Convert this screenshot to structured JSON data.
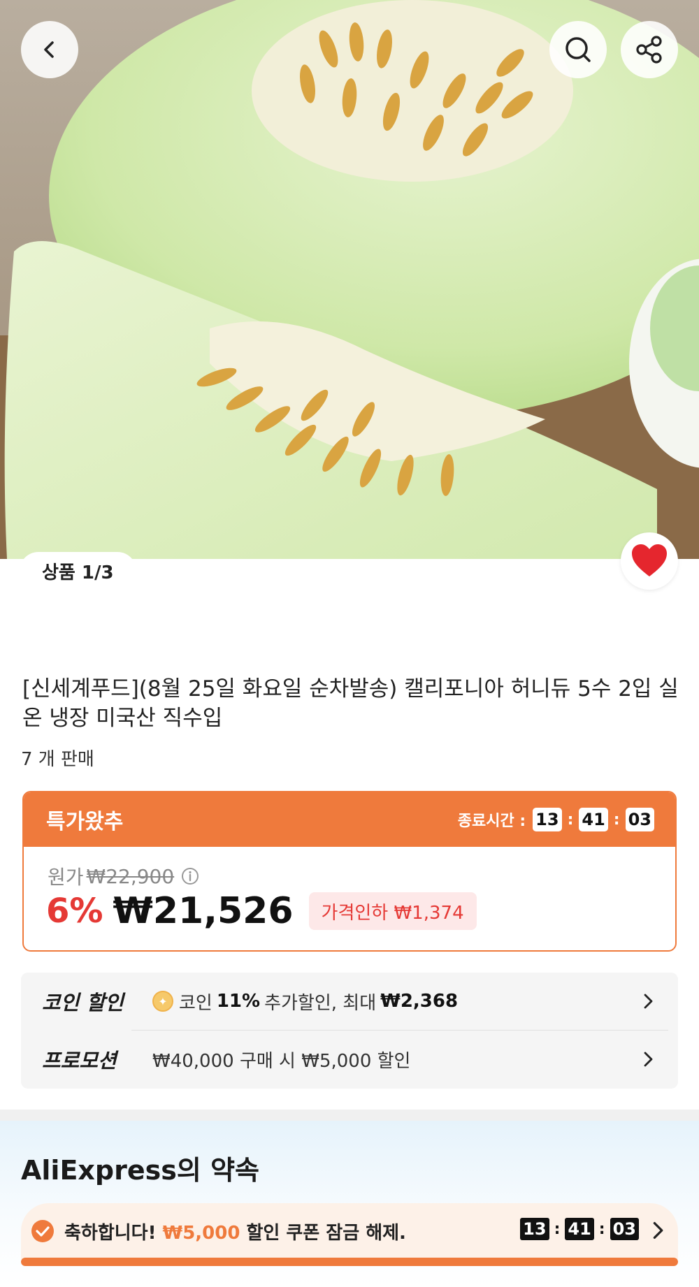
{
  "gallery": {
    "counter": "상품 1/3",
    "icons": {
      "back": "chevron-left-icon",
      "search": "search-icon",
      "share": "share-icon",
      "wishlist": "heart-icon"
    },
    "wishlisted": true
  },
  "product": {
    "title": "[신세계푸드](8월 25일 화요일 순차발송) 캘리포니아 허니듀 5수 2입 실온 냉장 미국산 직수입",
    "sold": "7 개 판매"
  },
  "deal": {
    "name": "특가왔추",
    "end_label": "종료시간 :",
    "timer": {
      "h": "13",
      "m": "41",
      "s": "03"
    },
    "original_label": "원가",
    "original_price": "₩22,900",
    "discount_pct": "6%",
    "price": "₩21,526",
    "price_cut": "가격인하 ₩1,374",
    "accent_color": "#ef7a3c"
  },
  "benefits": {
    "coin": {
      "label": "코인 할인",
      "prefix": "코인",
      "pct": "11%",
      "mid": "추가할인, 최대",
      "max": "₩2,368"
    },
    "promo": {
      "label": "프로모션",
      "text": "₩40,000 구매 시 ₩5,000 할인"
    }
  },
  "promise": {
    "title": "AliExpress의 약속",
    "unlock_prefix": "축하합니다!",
    "unlock_amount": "₩5,000",
    "unlock_suffix": "할인 쿠폰 잠금 해제.",
    "timer": {
      "h": "13",
      "m": "41",
      "s": "03"
    },
    "progress": 1.0
  }
}
